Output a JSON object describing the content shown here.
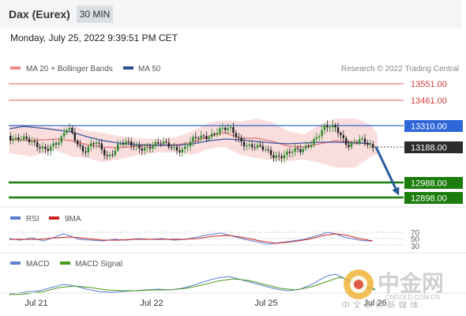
{
  "header": {
    "title": "Dax (Eurex)",
    "timeframe": "30 MIN",
    "timestamp": "Monday, July 25, 2022 9:39:51 PM CET"
  },
  "legend": {
    "ma20": "MA 20 + Bollinger Bands",
    "ma50": "MA 50",
    "credit": "Research © 2022 Trading Central"
  },
  "levels": [
    {
      "label": "13551.00",
      "type": "resistance"
    },
    {
      "label": "13461.00",
      "type": "resistance"
    },
    {
      "label": "13310.00",
      "type": "pivot"
    },
    {
      "label": "13188.00",
      "type": "last"
    },
    {
      "label": "12988.00",
      "type": "support"
    },
    {
      "label": "12898.00",
      "type": "support"
    }
  ],
  "rsi": {
    "label": "RSI",
    "ma_label": "9MA",
    "levels": [
      "70",
      "50",
      "30"
    ]
  },
  "macd": {
    "label": "MACD",
    "signal_label": "MACD Signal"
  },
  "xaxis": {
    "ticks": [
      "Jul 21",
      "Jul 22",
      "Jul 25",
      "Jul 26"
    ]
  },
  "watermark": {
    "name": "中金网",
    "url": "CNGOLD.COM.CN",
    "tagline": "中 文 财 经 新 媒 体"
  },
  "colors": {
    "ma20": "#e57373",
    "ma50": "#3f51b5",
    "pivot": "#2962ff",
    "support": "#1b7d0c",
    "resistance": "#e53935",
    "rsi": "#5c7fcf",
    "rsi_ma": "#cc2222",
    "macd": "#5c7fcf",
    "macd_signal": "#4a9a1c",
    "arrow": "#2a5b9c"
  },
  "chart_data": {
    "type": "candlestick",
    "series": [
      {
        "name": "MA 20 + Bollinger Bands"
      },
      {
        "name": "MA 50"
      }
    ],
    "price_levels": [
      13551.0,
      13461.0,
      13310.0,
      13188.0,
      12988.0,
      12898.0
    ],
    "last_price": 13188.0,
    "forecast": "down toward 12898.00",
    "x_ticks": [
      "Jul 21",
      "Jul 22",
      "Jul 25",
      "Jul 26"
    ]
  }
}
